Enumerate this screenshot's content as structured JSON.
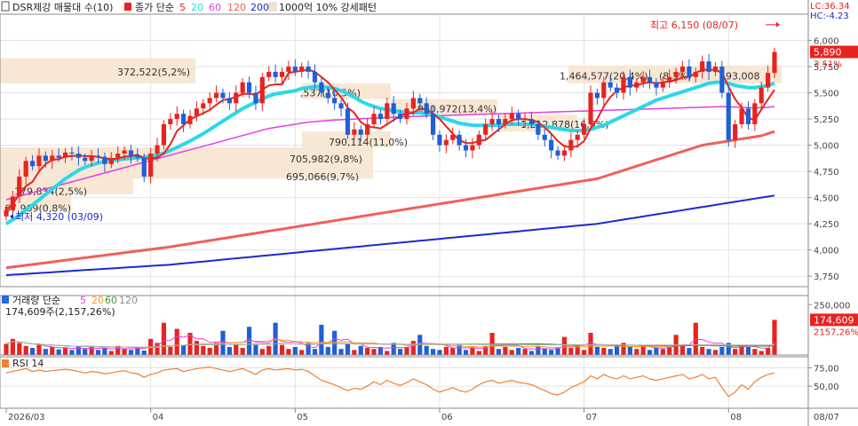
{
  "window": {
    "title": "DSR제강 매물대 수(10)",
    "legend": {
      "price_label": "종가 단순",
      "ma_periods": [
        "5",
        "20",
        "60",
        "120",
        "200"
      ],
      "ma_colors": [
        "#e8231f",
        "#2ad8e8",
        "#e23ee8",
        "#f0605a",
        "#1a2ad0"
      ],
      "pattern_label": "1000억 10% 강세패턴"
    },
    "top_right": {
      "lc": "LC:36.34",
      "hc": "HC:-4.23"
    }
  },
  "chart_data": [
    {
      "type": "candlestick",
      "ylim": [
        3650,
        6250
      ],
      "yticks": [
        "6,000",
        "5,750",
        "5,500",
        "5,250",
        "5,000",
        "4,750",
        "4,500",
        "4,250",
        "4,000",
        "3,750"
      ],
      "ytick_values": [
        6000,
        5750,
        5500,
        5250,
        5000,
        4750,
        4500,
        4250,
        4000,
        3750
      ],
      "current_price": {
        "value": 5890,
        "label": "5,890",
        "change": "3.51%"
      },
      "high_annotation": {
        "text": "최고 6,150 (08/07)",
        "value": 6150
      },
      "low_annotation": {
        "text": "최저 4,320 (03/09)",
        "value": 4320
      },
      "ohlc_close": [
        4380,
        4510,
        4700,
        4850,
        4800,
        4900,
        4850,
        4900,
        4880,
        4930,
        4920,
        4880,
        4850,
        4900,
        4890,
        4820,
        4880,
        4920,
        4950,
        4900,
        4880,
        4700,
        4920,
        5000,
        5200,
        5250,
        5300,
        5200,
        5280,
        5350,
        5400,
        5450,
        5500,
        5450,
        5400,
        5500,
        5600,
        5500,
        5400,
        5650,
        5700,
        5650,
        5700,
        5750,
        5700,
        5750,
        5700,
        5600,
        5500,
        5450,
        5400,
        5350,
        5100,
        5150,
        5100,
        5200,
        5300,
        5250,
        5400,
        5300,
        5250,
        5350,
        5450,
        5400,
        5300,
        5100,
        5000,
        5050,
        5100,
        5000,
        4950,
        5000,
        5100,
        5200,
        5250,
        5200,
        5250,
        5300,
        5250,
        5250,
        5200,
        5100,
        5050,
        4950,
        4900,
        4950,
        5050,
        5100,
        5200,
        5500,
        5450,
        5600,
        5550,
        5500,
        5650,
        5550,
        5600,
        5650,
        5600,
        5550,
        5600,
        5650,
        5700,
        5750,
        5650,
        5700,
        5800,
        5700,
        5750,
        5500,
        5050,
        5200,
        5350,
        5200,
        5400,
        5550,
        5690,
        5890
      ],
      "ma_series": [
        {
          "name": "5",
          "values": [
            4380,
            4440,
            4530,
            4610,
            4650,
            4750,
            4820,
            4860,
            4866,
            4892,
            4896,
            4902,
            4896,
            4896,
            4888,
            4872,
            4868,
            4872,
            4892,
            4894,
            4910,
            4870,
            4874,
            4880,
            4920,
            5010,
            5134,
            5190,
            5246,
            5276,
            5306,
            5336,
            5386,
            5430,
            5440,
            5460,
            5490,
            5490,
            5480,
            5530,
            5570,
            5580,
            5580,
            5690,
            5700,
            5710,
            5720,
            5700,
            5650,
            5600,
            5530,
            5460,
            5360,
            5310,
            5220,
            5180,
            5170,
            5160,
            5200,
            5240,
            5280,
            5300,
            5310,
            5350,
            5340,
            5300,
            5250,
            5180,
            5110,
            5050,
            5020,
            5020,
            5040,
            5050,
            5100,
            5150,
            5200,
            5240,
            5250,
            5250,
            5240,
            5220,
            5170,
            5110,
            5040,
            4990,
            4980,
            4990,
            5040,
            5160,
            5250,
            5370,
            5460,
            5520,
            5550,
            5570,
            5570,
            5590,
            5600,
            5590,
            5600,
            5610,
            5620,
            5650,
            5650,
            5690,
            5720,
            5720,
            5720,
            5690,
            5560,
            5440,
            5360,
            5260,
            5240,
            5340,
            5438,
            5528
          ]
        },
        {
          "name": "20",
          "values": [
            4250,
            4290,
            4330,
            4380,
            4430,
            4480,
            4530,
            4580,
            4630,
            4680,
            4720,
            4760,
            4790,
            4810,
            4830,
            4845,
            4855,
            4860,
            4870,
            4875,
            4880,
            4885,
            4895,
            4905,
            4925,
            4950,
            4980,
            5010,
            5040,
            5075,
            5110,
            5150,
            5190,
            5230,
            5270,
            5310,
            5350,
            5380,
            5410,
            5440,
            5470,
            5490,
            5500,
            5510,
            5520,
            5540,
            5550,
            5560,
            5560,
            5550,
            5540,
            5520,
            5490,
            5460,
            5420,
            5390,
            5370,
            5350,
            5340,
            5330,
            5320,
            5310,
            5310,
            5310,
            5300,
            5290,
            5270,
            5250,
            5230,
            5210,
            5200,
            5190,
            5190,
            5190,
            5190,
            5190,
            5200,
            5200,
            5200,
            5200,
            5200,
            5190,
            5180,
            5170,
            5160,
            5150,
            5140,
            5140,
            5140,
            5150,
            5170,
            5190,
            5220,
            5250,
            5280,
            5310,
            5340,
            5370,
            5400,
            5430,
            5450,
            5470,
            5490,
            5510,
            5530,
            5550,
            5570,
            5590,
            5600,
            5600,
            5590,
            5570,
            5560,
            5550,
            5550,
            5560,
            5570,
            5590
          ]
        },
        {
          "name": "60",
          "values": [
            4480,
            4497,
            4514,
            4531,
            4548,
            4565,
            4582,
            4599,
            4616,
            4633,
            4650,
            4667,
            4684,
            4701,
            4718,
            4735,
            4752,
            4769,
            4786,
            4803,
            4820,
            4837,
            4854,
            4871,
            4888,
            4905,
            4922,
            4939,
            4956,
            4973,
            4990,
            5007,
            5024,
            5041,
            5058,
            5075,
            5092,
            5109,
            5126,
            5143,
            5160,
            5170,
            5180,
            5190,
            5200,
            5210,
            5220,
            5225,
            5230,
            5235,
            5240,
            5243,
            5246,
            5249,
            5252,
            5255,
            5258,
            5261,
            5264,
            5267,
            5270,
            5272,
            5274,
            5276,
            5278,
            5280,
            5282,
            5284,
            5286,
            5288,
            5290,
            5292,
            5294,
            5296,
            5298,
            5300,
            5302,
            5304,
            5306,
            5308,
            5310,
            5312,
            5314,
            5316,
            5318,
            5320,
            5322,
            5324,
            5326,
            5328,
            5330,
            5332,
            5334,
            5336,
            5338,
            5340,
            5342,
            5344,
            5346,
            5348,
            5350,
            5352,
            5354,
            5356,
            5358,
            5360,
            5362,
            5364,
            5366,
            5368,
            5366,
            5364,
            5362,
            5358,
            5356,
            5358,
            5362,
            5368
          ]
        },
        {
          "name": "120",
          "values": [
            3830,
            3838,
            3846,
            3854,
            3862,
            3870,
            3878,
            3886,
            3894,
            3902,
            3910,
            3918,
            3926,
            3934,
            3942,
            3950,
            3958,
            3966,
            3974,
            3982,
            3990,
            3998,
            4006,
            4014,
            4022,
            4030,
            4040,
            4050,
            4060,
            4070,
            4080,
            4090,
            4100,
            4110,
            4120,
            4130,
            4140,
            4150,
            4160,
            4170,
            4180,
            4190,
            4200,
            4210,
            4220,
            4230,
            4240,
            4250,
            4260,
            4270,
            4280,
            4290,
            4300,
            4310,
            4320,
            4330,
            4340,
            4350,
            4360,
            4370,
            4380,
            4390,
            4400,
            4410,
            4420,
            4430,
            4440,
            4450,
            4460,
            4470,
            4480,
            4490,
            4500,
            4510,
            4520,
            4530,
            4540,
            4550,
            4560,
            4570,
            4580,
            4590,
            4600,
            4610,
            4620,
            4630,
            4640,
            4650,
            4660,
            4670,
            4680,
            4700,
            4720,
            4740,
            4760,
            4780,
            4800,
            4820,
            4840,
            4860,
            4880,
            4900,
            4920,
            4940,
            4960,
            4980,
            5000,
            5010,
            5020,
            5030,
            5040,
            5050,
            5060,
            5070,
            5080,
            5090,
            5110,
            5130
          ]
        },
        {
          "name": "200",
          "values": [
            3760,
            3764,
            3768,
            3772,
            3776,
            3780,
            3784,
            3788,
            3792,
            3796,
            3800,
            3804,
            3808,
            3812,
            3816,
            3820,
            3824,
            3828,
            3832,
            3836,
            3840,
            3844,
            3848,
            3852,
            3856,
            3860,
            3866,
            3872,
            3878,
            3884,
            3890,
            3896,
            3902,
            3908,
            3914,
            3920,
            3926,
            3932,
            3938,
            3944,
            3950,
            3956,
            3962,
            3968,
            3974,
            3980,
            3986,
            3992,
            3998,
            4004,
            4010,
            4016,
            4022,
            4028,
            4034,
            4040,
            4046,
            4052,
            4058,
            4064,
            4070,
            4076,
            4082,
            4088,
            4094,
            4100,
            4106,
            4112,
            4118,
            4124,
            4130,
            4136,
            4142,
            4148,
            4154,
            4160,
            4166,
            4172,
            4178,
            4184,
            4190,
            4196,
            4202,
            4208,
            4214,
            4220,
            4226,
            4232,
            4238,
            4244,
            4250,
            4260,
            4270,
            4280,
            4290,
            4300,
            4310,
            4320,
            4330,
            4340,
            4350,
            4360,
            4370,
            4380,
            4390,
            4400,
            4410,
            4420,
            4430,
            4440,
            4450,
            4460,
            4470,
            4480,
            4490,
            4500,
            4510,
            4520
          ]
        }
      ],
      "volume_profile": [
        {
          "label": "372,522(5,2%)",
          "low": 5590,
          "high": 5830
        },
        {
          "label": "1,464,577(20,4%)",
          "label2": "(8,3%)",
          "label3": "593,008",
          "low": 5590,
          "high": 5760
        },
        {
          "label": ",537(10,5%)",
          "low": 5440,
          "high": 5590
        },
        {
          "label": "960,972(13,4%)",
          "low": 5290,
          "high": 5440
        },
        {
          "label": "1,212,878(16,9%)",
          "low": 5130,
          "high": 5290
        },
        {
          "label": "790,114(11,0%)",
          "low": 4980,
          "high": 5130
        },
        {
          "label": "705,982(9,8%)",
          "low": 4830,
          "high": 4980
        },
        {
          "label": "695,066(9,7%)",
          "low": 4680,
          "high": 4830
        },
        {
          "label": "179,834(2,5%)",
          "low": 4530,
          "high": 4680
        },
        {
          "label": "67,969(0,8%)",
          "low": 4380,
          "high": 4530
        }
      ]
    },
    {
      "type": "bar",
      "title": "거래량 단순",
      "ma_periods": [
        "5",
        "20",
        "60",
        "120"
      ],
      "ma_colors": [
        "#e23ee8",
        "#f0a020",
        "#3a9a3a",
        "#b0b0b0"
      ],
      "annotation": "174,609주(2,157,26%)",
      "yticks": [
        "250,000"
      ],
      "ylim": [
        0,
        260000
      ],
      "current_value_label": "174,609",
      "current_change": "2157,26%",
      "values": [
        55000,
        80000,
        60000,
        45000,
        35000,
        50000,
        30000,
        40000,
        28000,
        35000,
        25000,
        45000,
        30000,
        40000,
        25000,
        35000,
        20000,
        45000,
        30000,
        25000,
        38000,
        22000,
        80000,
        60000,
        160000,
        40000,
        130000,
        50000,
        110000,
        70000,
        45000,
        35000,
        60000,
        120000,
        40000,
        55000,
        35000,
        140000,
        50000,
        30000,
        45000,
        160000,
        50000,
        30000,
        40000,
        25000,
        60000,
        30000,
        150000,
        40000,
        120000,
        30000,
        55000,
        25000,
        45000,
        35000,
        30000,
        40000,
        20000,
        60000,
        30000,
        40000,
        70000,
        100000,
        45000,
        30000,
        25000,
        40000,
        35000,
        50000,
        25000,
        35000,
        20000,
        45000,
        110000,
        30000,
        40000,
        25000,
        35000,
        30000,
        20000,
        45000,
        30000,
        25000,
        40000,
        90000,
        35000,
        50000,
        25000,
        110000,
        40000,
        35000,
        30000,
        45000,
        60000,
        40000,
        30000,
        50000,
        25000,
        35000,
        30000,
        40000,
        100000,
        50000,
        35000,
        160000,
        40000,
        30000,
        25000,
        40000,
        60000,
        30000,
        50000,
        40000,
        30000,
        20000,
        35000,
        174609
      ]
    },
    {
      "type": "line",
      "title": "RSI 14",
      "ylim": [
        20,
        90
      ],
      "yticks": [
        "75,00",
        "50,00"
      ],
      "ytick_values": [
        75,
        50
      ],
      "values": [
        68,
        70,
        72,
        74,
        70,
        72,
        70,
        71,
        72,
        73,
        72,
        70,
        68,
        70,
        69,
        67,
        68,
        70,
        71,
        68,
        67,
        62,
        66,
        68,
        72,
        73,
        74,
        70,
        72,
        74,
        75,
        76,
        74,
        72,
        70,
        72,
        74,
        70,
        66,
        72,
        74,
        72,
        73,
        74,
        72,
        73,
        70,
        64,
        58,
        55,
        52,
        48,
        44,
        47,
        46,
        50,
        56,
        52,
        58,
        54,
        51,
        55,
        60,
        56,
        52,
        46,
        42,
        45,
        48,
        44,
        42,
        46,
        52,
        56,
        58,
        54,
        56,
        58,
        55,
        54,
        52,
        48,
        44,
        40,
        38,
        42,
        48,
        52,
        56,
        64,
        60,
        66,
        62,
        60,
        64,
        60,
        62,
        64,
        60,
        58,
        60,
        62,
        64,
        66,
        60,
        62,
        66,
        60,
        62,
        48,
        36,
        42,
        52,
        46,
        56,
        62,
        66,
        68
      ]
    }
  ],
  "xaxis": {
    "labels": [
      "2026/03",
      "04",
      "05",
      "06",
      "07",
      "08"
    ],
    "label_indices": [
      0,
      22,
      44,
      66,
      88,
      110
    ],
    "right_label": "08/07"
  }
}
